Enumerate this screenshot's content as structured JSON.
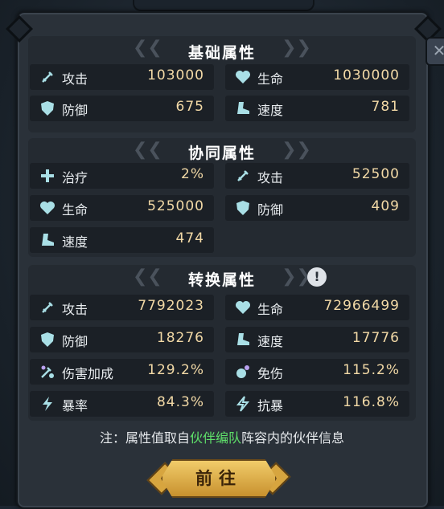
{
  "sections": [
    {
      "title": "基础属性",
      "stats": [
        {
          "icon": "sword-icon",
          "label": "攻击",
          "value": "103000"
        },
        {
          "icon": "heart-icon",
          "label": "生命",
          "value": "1030000"
        },
        {
          "icon": "shield-icon",
          "label": "防御",
          "value": "675"
        },
        {
          "icon": "boot-icon",
          "label": "速度",
          "value": "781"
        }
      ]
    },
    {
      "title": "协同属性",
      "stats": [
        {
          "icon": "heal-cross-icon",
          "label": "治疗",
          "value": "2%"
        },
        {
          "icon": "sword-icon",
          "label": "攻击",
          "value": "52500"
        },
        {
          "icon": "heart-icon",
          "label": "生命",
          "value": "525000"
        },
        {
          "icon": "shield-icon",
          "label": "防御",
          "value": "409"
        },
        {
          "icon": "boot-icon",
          "label": "速度",
          "value": "474"
        }
      ]
    },
    {
      "title": "转换属性",
      "stats": [
        {
          "icon": "sword-icon",
          "label": "攻击",
          "value": "7792023"
        },
        {
          "icon": "heart-icon",
          "label": "生命",
          "value": "72966499"
        },
        {
          "icon": "shield-icon",
          "label": "防御",
          "value": "18276"
        },
        {
          "icon": "boot-icon",
          "label": "速度",
          "value": "17776"
        },
        {
          "icon": "damage-boost-icon",
          "label": "伤害加成",
          "value": "129.2%"
        },
        {
          "icon": "damage-reduction-icon",
          "label": "免伤",
          "value": "115.2%"
        },
        {
          "icon": "crit-icon",
          "label": "暴率",
          "value": "84.3%"
        },
        {
          "icon": "crit-resist-icon",
          "label": "抗暴",
          "value": "116.8%"
        }
      ]
    }
  ],
  "info_symbol": "!",
  "close_symbol": "✕",
  "note": {
    "prefix": "注：属性值取自",
    "highlight": "伙伴编队",
    "suffix": "阵容内的伙伴信息"
  },
  "go_button": "前往",
  "colors": {
    "value": "#f2d9a6",
    "highlight": "#5fe06a",
    "icon": "#a9dfe6"
  }
}
